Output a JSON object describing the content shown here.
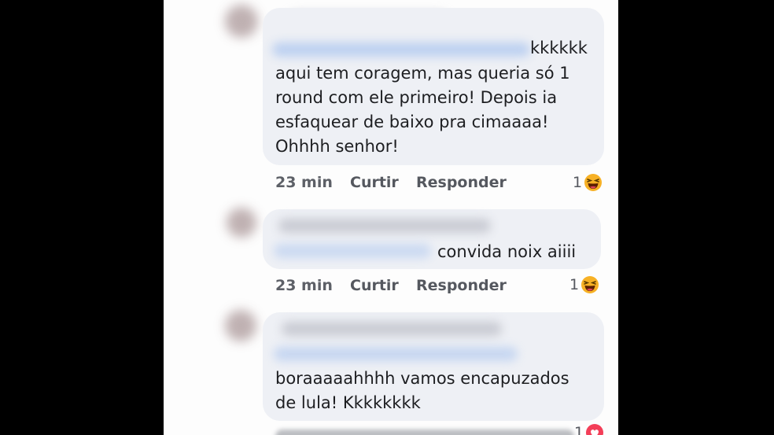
{
  "comments": [
    {
      "text_partial": "kkkkkk",
      "text": "aqui tem coragem, mas queria só 1\nround com ele primeiro! Depois ia\nesfaquear de baixo pra cimaaaa!\nOhhhh senhor!",
      "time": "23 min",
      "like_label": "Curtir",
      "reply_label": "Responder",
      "reaction_count": "1",
      "reaction_icon": "haha-emoji-icon"
    },
    {
      "text": "convida noix aiiii",
      "time": "23 min",
      "like_label": "Curtir",
      "reply_label": "Responder",
      "reaction_count": "1",
      "reaction_icon": "haha-emoji-icon"
    },
    {
      "text": "boraaaaahhhh vamos encapuzados\nde lula! Kkkkkkkk",
      "reaction_count": "1",
      "reaction_icon": "love-icon"
    }
  ],
  "colors": {
    "bubble": "#eef0f5",
    "meta_text": "#55585f",
    "haha_yellow": "#f7b125",
    "love_red": "#f33e58"
  }
}
